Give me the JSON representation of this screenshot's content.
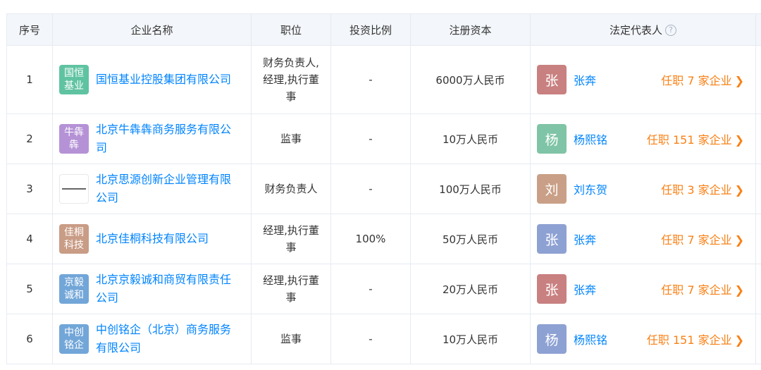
{
  "headers": {
    "index": "序号",
    "company": "企业名称",
    "position": "职位",
    "ratio": "投资比例",
    "capital": "注册资本",
    "legal": "法定代表人"
  },
  "rows": [
    {
      "index": "1",
      "logo_text": "国恒\n基业",
      "logo_color": "#5fc3a1",
      "company": "国恒基业控股集团有限公司",
      "position": "财务负责人,\n经理,执行董\n事",
      "ratio": "-",
      "capital": "6000万人民币",
      "avatar_char": "张",
      "avatar_color": "#c98080",
      "person": "张奔",
      "jobs": "任职 7 家企业"
    },
    {
      "index": "2",
      "logo_text": "牛犇\n犇",
      "logo_color": "#b592d6",
      "company": "北京牛犇犇商务服务有限公\n司",
      "position": "监事",
      "ratio": "-",
      "capital": "10万人民币",
      "avatar_char": "杨",
      "avatar_color": "#7fc4a6",
      "person": "杨熙铭",
      "jobs": "任职 151 家企业"
    },
    {
      "index": "3",
      "logo_text": "",
      "logo_color": "#ffffff",
      "company": "北京思源创新企业管理有限\n公司",
      "position": "财务负责人",
      "ratio": "-",
      "capital": "100万人民币",
      "avatar_char": "刘",
      "avatar_color": "#c9a087",
      "person": "刘东贺",
      "jobs": "任职 3 家企业"
    },
    {
      "index": "4",
      "logo_text": "佳桐\n科技",
      "logo_color": "#c99c86",
      "company": "北京佳桐科技有限公司",
      "position": "经理,执行董\n事",
      "ratio": "100%",
      "capital": "50万人民币",
      "avatar_char": "张",
      "avatar_color": "#8ea1d3",
      "person": "张奔",
      "jobs": "任职 7 家企业"
    },
    {
      "index": "5",
      "logo_text": "京毅\n诚和",
      "logo_color": "#72a6d8",
      "company": "北京京毅诚和商贸有限责任\n公司",
      "position": "经理,执行董\n事",
      "ratio": "-",
      "capital": "20万人民币",
      "avatar_char": "张",
      "avatar_color": "#c98080",
      "person": "张奔",
      "jobs": "任职 7 家企业"
    },
    {
      "index": "6",
      "logo_text": "中创\n铭企",
      "logo_color": "#72a6d8",
      "company": "中创铭企（北京）商务服务\n有限公司",
      "position": "监事",
      "ratio": "-",
      "capital": "10万人民币",
      "avatar_char": "杨",
      "avatar_color": "#8ea1d3",
      "person": "杨熙铭",
      "jobs": "任职 151 家企业"
    }
  ],
  "icons": {
    "help": "question-circle-icon",
    "chevron": "chevron-right-icon"
  },
  "colors": {
    "link": "#0084ff",
    "accent": "#fa8014",
    "header_bg": "#f3f6fa",
    "border": "#e6ebf2"
  }
}
